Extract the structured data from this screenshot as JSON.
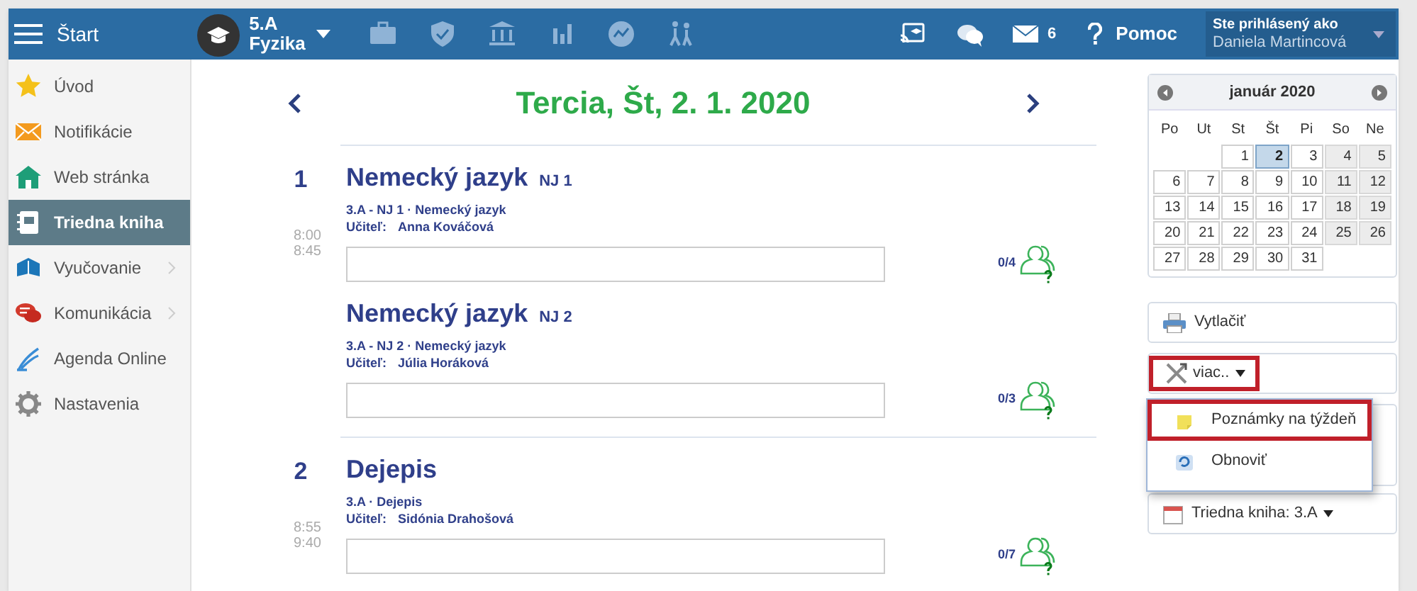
{
  "top_bar": {
    "home_label": "Štart",
    "class_selector": {
      "class": "5.A",
      "subject": "Fyzika"
    },
    "mail_count": "6",
    "help_label": "Pomoc",
    "user": {
      "caption": "Ste prihlásený ako",
      "name": "Daniela Martincová"
    }
  },
  "sidebar": {
    "items": [
      {
        "label": "Úvod",
        "selected": false,
        "has_submenu": false
      },
      {
        "label": "Notifikácie",
        "selected": false,
        "has_submenu": false
      },
      {
        "label": "Web stránka",
        "selected": false,
        "has_submenu": false
      },
      {
        "label": "Triedna kniha",
        "selected": true,
        "has_submenu": false
      },
      {
        "label": "Vyučovanie",
        "selected": false,
        "has_submenu": true
      },
      {
        "label": "Komunikácia",
        "selected": false,
        "has_submenu": true
      },
      {
        "label": "Agenda Online",
        "selected": false,
        "has_submenu": false
      },
      {
        "label": "Nastavenia",
        "selected": false,
        "has_submenu": false
      }
    ]
  },
  "day_header": {
    "title": "Tercia, Št, 2. 1. 2020"
  },
  "periods": [
    {
      "number": "1",
      "start": "8:00",
      "end": "8:45",
      "lessons": [
        {
          "subject": "Nemecký jazyk",
          "group": "NJ 1",
          "detail": "3.A - NJ 1 · Nemecký jazyk",
          "teacher_label": "Učiteľ:",
          "teacher": "Anna Kováčová",
          "attendance": "0/4"
        },
        {
          "subject": "Nemecký jazyk",
          "group": "NJ 2",
          "detail": "3.A - NJ 2 · Nemecký jazyk",
          "teacher_label": "Učiteľ:",
          "teacher": "Júlia Horáková",
          "attendance": "0/3"
        }
      ]
    },
    {
      "number": "2",
      "start": "8:55",
      "end": "9:40",
      "lessons": [
        {
          "subject": "Dejepis",
          "detail": "3.A · Dejepis",
          "teacher_label": "Učiteľ:",
          "teacher": "Sidónia Drahošová",
          "attendance": "0/7"
        }
      ]
    }
  ],
  "calendar": {
    "month": "január 2020",
    "weekdays": [
      "Po",
      "Ut",
      "St",
      "Št",
      "Pi",
      "So",
      "Ne"
    ],
    "weeks": [
      [
        {
          "day": "1",
          "selected": false
        },
        {
          "day": "2",
          "selected": true
        },
        {
          "day": "3",
          "selected": false
        },
        {
          "day": "4",
          "selected": false
        },
        {
          "day": "5",
          "selected": false
        }
      ],
      [
        {
          "day": "6",
          "selected": false
        },
        {
          "day": "7",
          "selected": false
        },
        {
          "day": "8",
          "selected": false
        },
        {
          "day": "9",
          "selected": false
        },
        {
          "day": "10",
          "selected": false
        },
        {
          "day": "11",
          "selected": false
        },
        {
          "day": "12",
          "selected": false
        }
      ],
      [
        {
          "day": "13",
          "selected": false
        },
        {
          "day": "14",
          "selected": false
        },
        {
          "day": "15",
          "selected": false
        },
        {
          "day": "16",
          "selected": false
        },
        {
          "day": "17",
          "selected": false
        },
        {
          "day": "18",
          "selected": false
        },
        {
          "day": "19",
          "selected": false
        }
      ],
      [
        {
          "day": "20",
          "selected": false
        },
        {
          "day": "21",
          "selected": false
        },
        {
          "day": "22",
          "selected": false
        },
        {
          "day": "23",
          "selected": false
        },
        {
          "day": "24",
          "selected": false
        },
        {
          "day": "25",
          "selected": false
        },
        {
          "day": "26",
          "selected": false
        }
      ],
      [
        {
          "day": "27",
          "selected": false
        },
        {
          "day": "28",
          "selected": false
        },
        {
          "day": "29",
          "selected": false
        },
        {
          "day": "30",
          "selected": false
        },
        {
          "day": "31",
          "selected": false
        }
      ]
    ]
  },
  "actions": {
    "print_label": "Vytlačiť",
    "more": {
      "label": "viac..",
      "highlighted": true,
      "expanded": true
    },
    "menu_items": [
      {
        "label": "Poznámky na týždeň",
        "highlighted": true
      },
      {
        "label": "Obnoviť",
        "highlighted": false
      }
    ],
    "class_book_label": "Triedna kniha: 3.A"
  }
}
